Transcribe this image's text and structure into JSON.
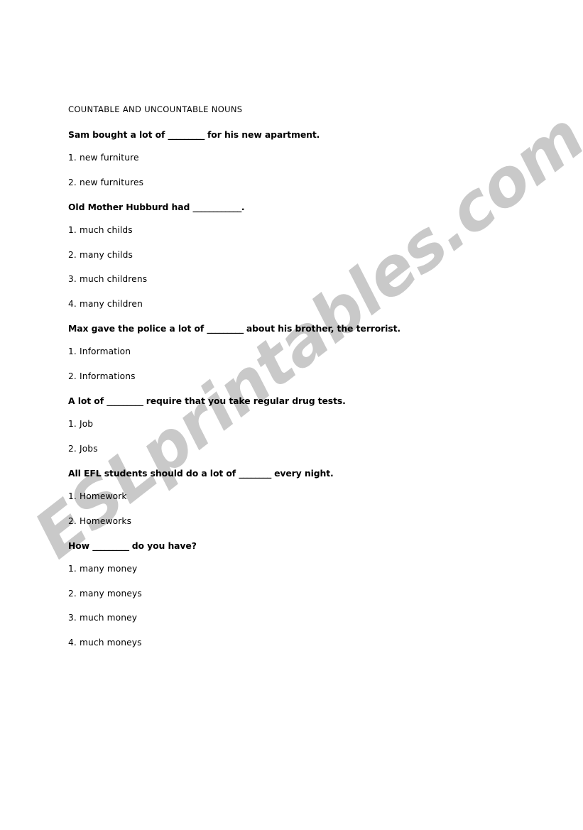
{
  "watermark": {
    "text": "ESLprintables.com",
    "color": "#c9c9c9"
  },
  "worksheet": {
    "title": "COUNTABLE AND UNCOUNTABLE NOUNS",
    "text_color": "#000000",
    "background_color": "#ffffff",
    "questions": [
      {
        "prompt_before": "Sam bought a lot of ",
        "blank": "_________",
        "prompt_after": " for his new apartment.",
        "options": [
          "1. new furniture",
          "2. new furnitures"
        ]
      },
      {
        "prompt_before": "Old Mother Hubburd had ",
        "blank": "____________",
        "prompt_after": ".",
        "options": [
          "1. much childs",
          "2. many childs",
          "3. much childrens",
          "4. many children"
        ]
      },
      {
        "prompt_before": "Max gave the police a lot of ",
        "blank": "_________",
        "prompt_after": " about his brother, the terrorist.",
        "options": [
          "1. Information",
          "2. Informations"
        ]
      },
      {
        "prompt_before": "A lot of ",
        "blank": "_________",
        "prompt_after": " require that you take regular drug tests.",
        "options": [
          "1. Job",
          "2. Jobs"
        ]
      },
      {
        "prompt_before": "All EFL students should do a lot of ",
        "blank": "________",
        "prompt_after": " every night.",
        "options": [
          "1. Homework",
          "2. Homeworks"
        ]
      },
      {
        "prompt_before": "How ",
        "blank": "_________",
        "prompt_after": " do you have?",
        "options": [
          "1. many money",
          "2. many moneys",
          "3. much money",
          "4. much moneys"
        ]
      }
    ]
  }
}
